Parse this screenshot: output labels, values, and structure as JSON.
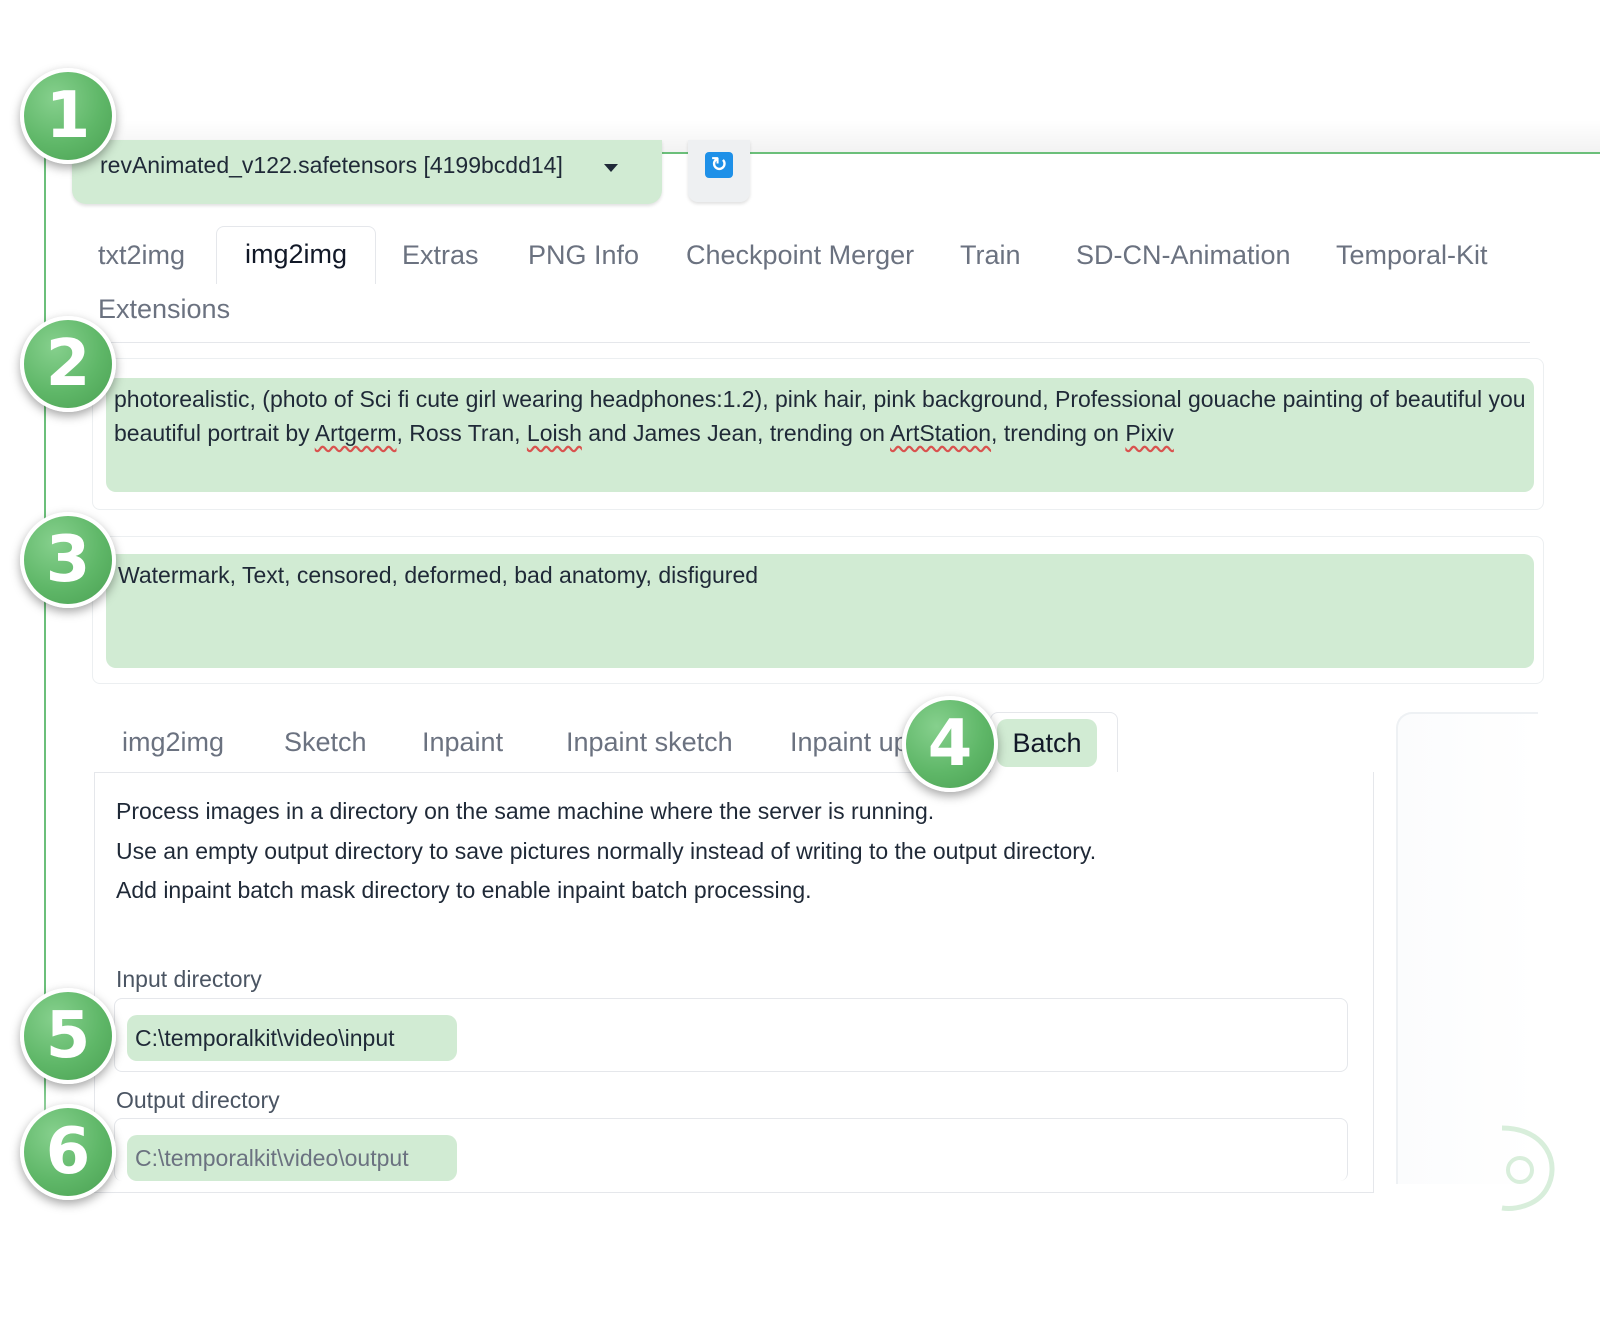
{
  "model": {
    "selected": "revAnimated_v122.safetensors [4199bcdd14]",
    "refresh_icon": "refresh-icon"
  },
  "main_tabs": [
    {
      "label": "txt2img"
    },
    {
      "label": "img2img",
      "active": true
    },
    {
      "label": "Extras"
    },
    {
      "label": "PNG Info"
    },
    {
      "label": "Checkpoint Merger"
    },
    {
      "label": "Train"
    },
    {
      "label": "SD-CN-Animation"
    },
    {
      "label": "Temporal-Kit"
    },
    {
      "label": "Extensions"
    }
  ],
  "prompt": {
    "line1": "photorealistic, (photo of Sci fi cute girl wearing headphones:1.2), pink hair, pink background, Professional gouache painting of beautiful you",
    "line2_pre": "beautiful portrait by ",
    "artgerm": "Artgerm",
    "after_artgerm": ", Ross Tran, ",
    "loish": "Loish",
    "after_loish": " and James Jean, trending on ",
    "artstation": "ArtStation",
    "after_artstation": ", trending on ",
    "pixiv": "Pixiv"
  },
  "negative_prompt": {
    "value": "Watermark, Text, censored, deformed, bad anatomy, disfigured"
  },
  "sub_tabs": [
    {
      "label": "img2img"
    },
    {
      "label": "Sketch"
    },
    {
      "label": "Inpaint"
    },
    {
      "label": "Inpaint sketch"
    },
    {
      "label": "Inpaint up"
    },
    {
      "label": "Batch",
      "active": true
    }
  ],
  "batch": {
    "info": [
      "Process images in a directory on the same machine where the server is running.",
      "Use an empty output directory to save pictures normally instead of writing to the output directory.",
      "Add inpaint batch mask directory to enable inpaint batch processing."
    ],
    "input_label": "Input directory",
    "input_value": "C:\\temporalkit\\video\\input",
    "output_label": "Output directory",
    "output_value": "C:\\temporalkit\\video\\output"
  },
  "badges": [
    "1",
    "2",
    "3",
    "4",
    "5",
    "6"
  ],
  "colors": {
    "accent_green": "#d1ebd3",
    "badge_green": "#5fb768",
    "refresh_blue": "#1e90e8"
  }
}
